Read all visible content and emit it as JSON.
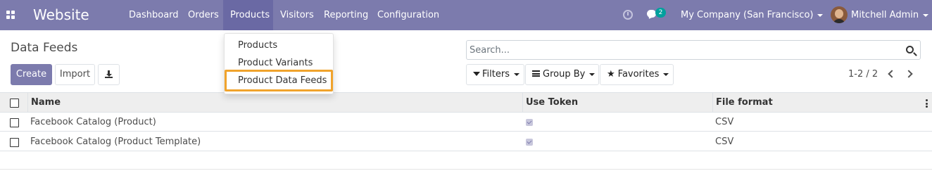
{
  "navbar": {
    "brand": "Website",
    "menu": [
      "Dashboard",
      "Orders",
      "Products",
      "Visitors",
      "Reporting",
      "Configuration"
    ],
    "active_menu": "Products",
    "chat_count": "2",
    "company": "My Company (San Francisco)",
    "user": "Mitchell Admin",
    "accent_color": "#7c7bad"
  },
  "control_panel": {
    "breadcrumb": "Data Feeds",
    "create_label": "Create",
    "import_label": "Import",
    "search_placeholder": "Search...",
    "filters_label": "Filters",
    "groupby_label": "Group By",
    "favorites_label": "Favorites",
    "pager": "1-2 / 2"
  },
  "dropdown": {
    "items": [
      "Products",
      "Product Variants",
      "Product Data Feeds"
    ],
    "highlighted": "Product Data Feeds",
    "highlight_color": "#f0a32c"
  },
  "table": {
    "columns": [
      "Name",
      "Use Token",
      "File format"
    ],
    "rows": [
      {
        "name": "Facebook Catalog (Product)",
        "use_token": true,
        "file_format": "CSV"
      },
      {
        "name": "Facebook Catalog (Product Template)",
        "use_token": true,
        "file_format": "CSV"
      }
    ]
  }
}
